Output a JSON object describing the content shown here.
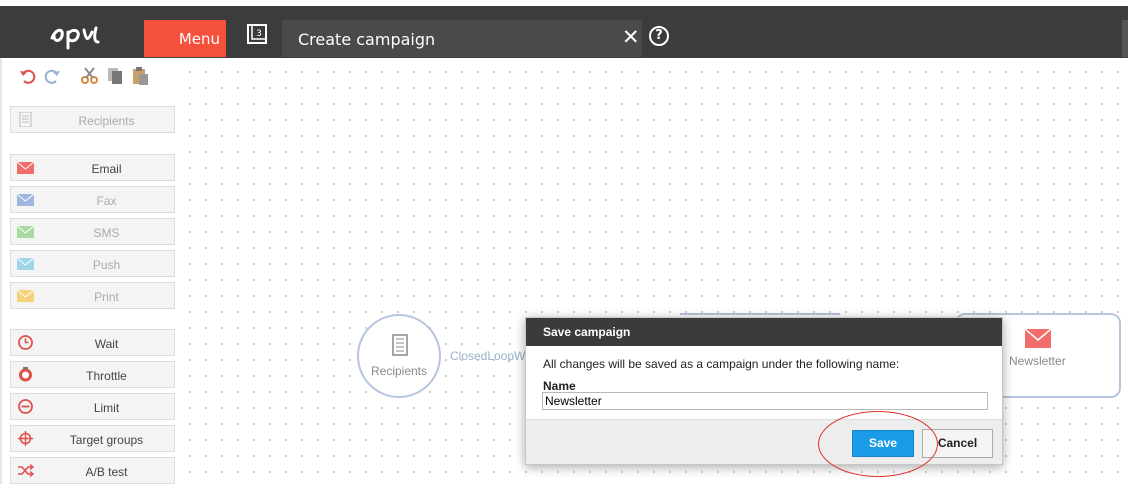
{
  "header": {
    "logo_text": "epi",
    "menu_label": "Menu",
    "badge_count": "3",
    "title": "Create campaign",
    "close_symbol": "✕",
    "help_symbol": "?"
  },
  "toolbar": {
    "icons": [
      "undo-icon",
      "redo-icon",
      "cut-icon",
      "copy-icon",
      "paste-icon"
    ]
  },
  "sidebar": {
    "items": [
      {
        "label": "Recipients",
        "icon": "document-icon",
        "enabled": false
      },
      {
        "label": "Email",
        "icon": "envelope-icon",
        "enabled": true
      },
      {
        "label": "Fax",
        "icon": "envelope-icon",
        "enabled": false
      },
      {
        "label": "SMS",
        "icon": "envelope-icon",
        "enabled": false
      },
      {
        "label": "Push",
        "icon": "envelope-icon",
        "enabled": false
      },
      {
        "label": "Print",
        "icon": "envelope-icon",
        "enabled": false
      },
      {
        "label": "Wait",
        "icon": "clock-icon",
        "enabled": true
      },
      {
        "label": "Throttle",
        "icon": "gauge-icon",
        "enabled": true
      },
      {
        "label": "Limit",
        "icon": "minus-circle-icon",
        "enabled": true
      },
      {
        "label": "Target groups",
        "icon": "crosshair-icon",
        "enabled": true
      },
      {
        "label": "A/B test",
        "icon": "shuffle-icon",
        "enabled": true
      }
    ]
  },
  "flow": {
    "recipients_label": "Recipients",
    "flow_label": "ClosedLoopW",
    "newsletter_label": "Newsletter"
  },
  "dialog": {
    "title": "Save campaign",
    "message": "All changes will be saved as a campaign under the following name:",
    "name_label": "Name",
    "name_value": "Newsletter",
    "save_label": "Save",
    "cancel_label": "Cancel"
  },
  "colors": {
    "topbar": "#3c3c3c",
    "accent": "#f4503b",
    "primary_button": "#1a9be8",
    "email_icon": "#f36d6d",
    "fax_icon": "#9fb6e3",
    "sms_icon": "#a7d9a0",
    "push_icon": "#9fd6ea",
    "print_icon": "#f5d27a",
    "highlight": "#e0302b"
  }
}
